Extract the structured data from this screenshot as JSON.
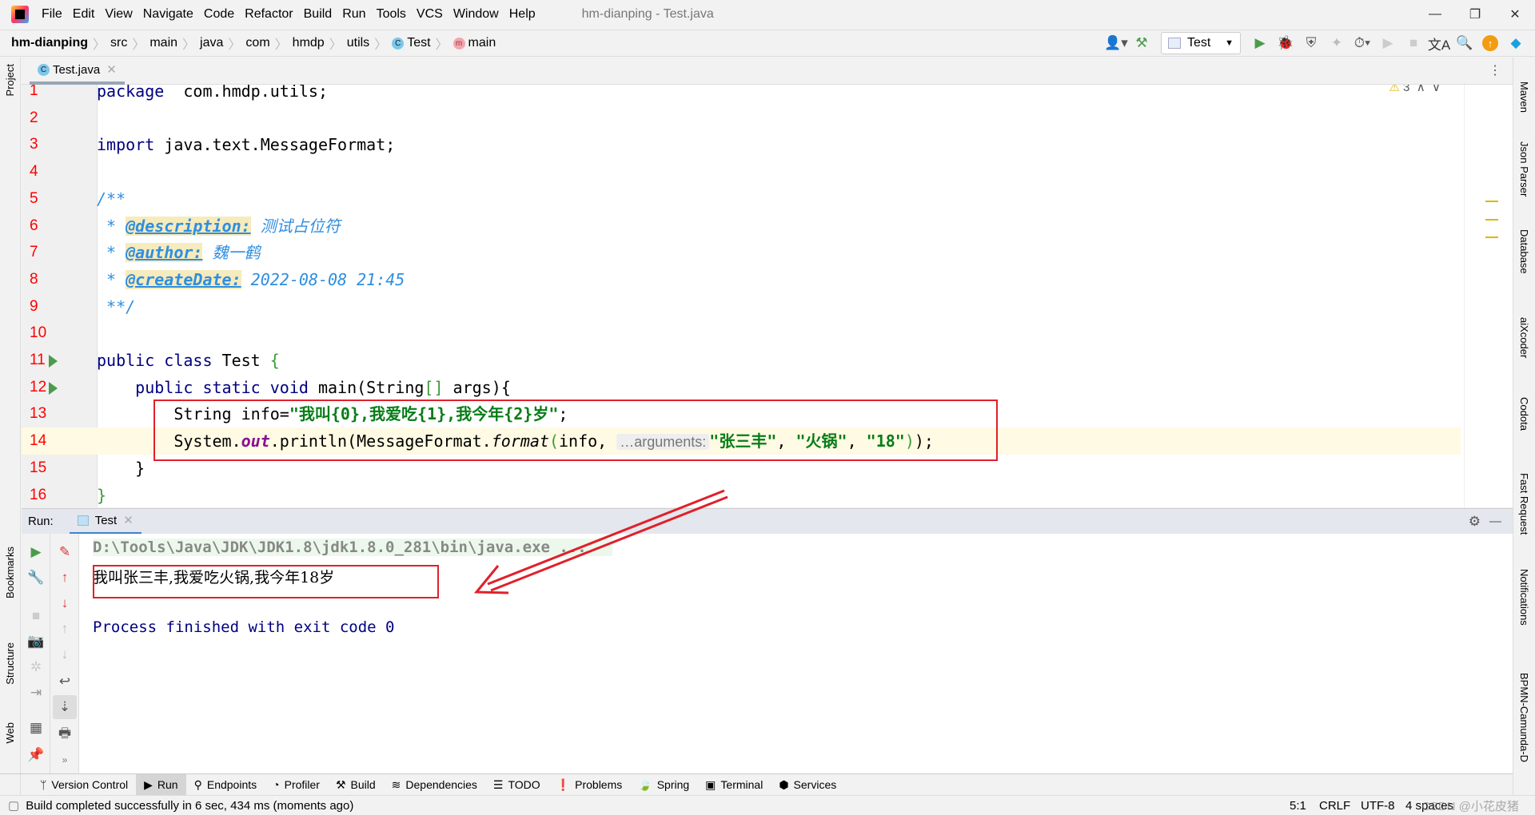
{
  "window": {
    "title": "hm-dianping - Test.java",
    "controls": [
      "—",
      "❐",
      "✕"
    ]
  },
  "menu": [
    "File",
    "Edit",
    "View",
    "Navigate",
    "Code",
    "Refactor",
    "Build",
    "Run",
    "Tools",
    "VCS",
    "Window",
    "Help"
  ],
  "breadcrumb": [
    "hm-dianping",
    "src",
    "main",
    "java",
    "com",
    "hmdp",
    "utils",
    "Test",
    "main"
  ],
  "toolbar": {
    "run_config": "Test",
    "icons": [
      "user-icon",
      "build-hammer-icon",
      "run-icon",
      "debug-icon",
      "coverage-icon",
      "profile-icon",
      "run-with-icon",
      "resume-icon",
      "stop-icon",
      "translate-icon",
      "search-icon",
      "update-icon",
      "plugin-icon"
    ]
  },
  "left_stripe": [
    "Project",
    "Bookmarks",
    "Structure",
    "Web"
  ],
  "right_stripe": [
    "Maven",
    "Json Parser",
    "Database",
    "aiXcoder",
    "Codota",
    "Fast Request",
    "Notifications",
    "BPMN-Camunda-D"
  ],
  "editor": {
    "tab": "Test.java",
    "warnings": "3",
    "lines": [
      [
        [
          "kw",
          "package"
        ],
        [
          "",
          "  com.hmdp.utils;"
        ]
      ],
      [],
      [
        [
          "kw",
          "import"
        ],
        [
          "",
          " java.text.MessageFormat;"
        ]
      ],
      [],
      [
        [
          "doc",
          "/**"
        ]
      ],
      [
        [
          "doc",
          " * "
        ],
        [
          "tag",
          "@description:"
        ],
        [
          "doc",
          " 测试占位符"
        ]
      ],
      [
        [
          "doc",
          " * "
        ],
        [
          "tag",
          "@author:"
        ],
        [
          "doc",
          " 魏一鹤"
        ]
      ],
      [
        [
          "doc",
          " * "
        ],
        [
          "tag",
          "@createDate:"
        ],
        [
          "doc",
          " 2022-08-08 21:45"
        ]
      ],
      [
        [
          "doc",
          " **/"
        ]
      ],
      [],
      [
        [
          "kw",
          "public class"
        ],
        [
          "",
          " Test "
        ],
        [
          "brace",
          "{"
        ]
      ],
      [
        [
          "kw",
          "    public static void"
        ],
        [
          "",
          " main(String"
        ],
        [
          "brace",
          "[]"
        ],
        [
          "",
          " args){"
        ]
      ],
      [
        [
          "",
          "        String info="
        ],
        [
          "str",
          "\"我叫{0},我爱吃{1},我今年{2}岁\""
        ],
        [
          "",
          ";"
        ]
      ],
      [
        [
          "",
          "        System."
        ],
        [
          "fld",
          "out"
        ],
        [
          "",
          ".println(MessageFormat."
        ],
        [
          "ital",
          "format"
        ],
        [
          "brace",
          "("
        ],
        [
          "",
          "info, "
        ],
        [
          "hint",
          "…arguments:"
        ],
        [
          "str",
          "\"张三丰\""
        ],
        [
          "",
          ", "
        ],
        [
          "str",
          "\"火锅\""
        ],
        [
          "",
          ", "
        ],
        [
          "str",
          "\"18\""
        ],
        [
          "brace",
          ")"
        ],
        [
          "",
          ");"
        ]
      ],
      [
        [
          "",
          "    }"
        ]
      ],
      [
        [
          "brace",
          "}"
        ]
      ]
    ]
  },
  "run": {
    "label": "Run:",
    "tab": "Test",
    "console": [
      "D:\\Tools\\Java\\JDK\\JDK1.8\\jdk1.8.0_281\\bin\\java.exe ...",
      "我叫张三丰,我爱吃火锅,我今年18岁",
      "",
      "Process finished with exit code 0"
    ]
  },
  "bottom_tabs": [
    "Version Control",
    "Run",
    "Endpoints",
    "Profiler",
    "Build",
    "Dependencies",
    "TODO",
    "Problems",
    "Spring",
    "Terminal",
    "Services"
  ],
  "status": {
    "message": "Build completed successfully in 6 sec, 434 ms (moments ago)",
    "position": "5:1",
    "line_sep": "CRLF",
    "encoding": "UTF-8",
    "indent": "4 spaces",
    "watermark": "CSDN @小花皮猪"
  },
  "colors": {
    "annotation_red": "#e0202a",
    "line_number": "#ff0000",
    "keyword": "#000080",
    "string": "#067d17"
  }
}
